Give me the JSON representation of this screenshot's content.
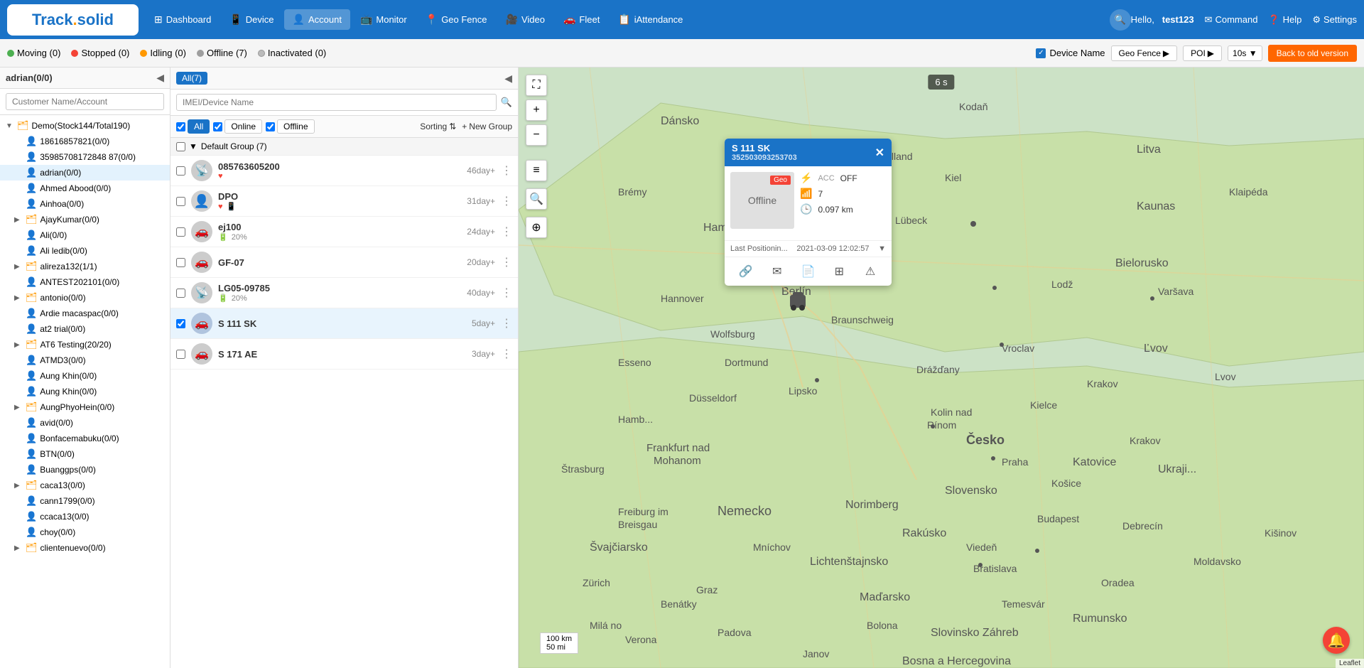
{
  "app": {
    "title": "Track solid"
  },
  "nav": {
    "logo": "Track solid",
    "items": [
      {
        "label": "Dashboard",
        "icon": "⊞",
        "key": "dashboard"
      },
      {
        "label": "Device",
        "icon": "📱",
        "key": "device"
      },
      {
        "label": "Account",
        "icon": "👤",
        "key": "account",
        "active": true
      },
      {
        "label": "Monitor",
        "icon": "📺",
        "key": "monitor"
      },
      {
        "label": "Geo Fence",
        "icon": "📍",
        "key": "geo-fence"
      },
      {
        "label": "Video",
        "icon": "🎥",
        "key": "video"
      },
      {
        "label": "Fleet",
        "icon": "🚗",
        "key": "fleet"
      },
      {
        "label": "iAttendance",
        "icon": "📋",
        "key": "iattendance"
      }
    ],
    "hello_text": "Hello,",
    "username": "test123",
    "command": "Command",
    "help": "Help",
    "settings": "Settings"
  },
  "status_bar": {
    "moving": {
      "label": "Moving",
      "count": "0"
    },
    "stopped": {
      "label": "Stopped",
      "count": "0"
    },
    "idling": {
      "label": "Idling",
      "count": "0"
    },
    "offline": {
      "label": "Offline",
      "count": "7"
    },
    "inactivated": {
      "label": "Inactivated",
      "count": "0"
    },
    "device_name_label": "Device Name",
    "geo_fence_label": "Geo Fence",
    "poi_label": "POI",
    "interval": "10s",
    "back_old_version": "Back to old version"
  },
  "sidebar": {
    "title": "adrian(0/0)",
    "search_placeholder": "Customer Name/Account",
    "accounts": [
      {
        "label": "Demo(Stock144/Total190)",
        "type": "folder",
        "level": 0,
        "expanded": true
      },
      {
        "label": "18616857821(0/0)",
        "type": "person-orange",
        "level": 1
      },
      {
        "label": "35985708172848 87(0/0)",
        "type": "person-orange",
        "level": 1
      },
      {
        "label": "adrian(0/0)",
        "type": "person-orange",
        "level": 1,
        "selected": true
      },
      {
        "label": "Ahmed Abood(0/0)",
        "type": "person",
        "level": 1
      },
      {
        "label": "Ainhoa(0/0)",
        "type": "person",
        "level": 1
      },
      {
        "label": "AjayKumar(0/0)",
        "type": "folder",
        "level": 1,
        "expanded": false
      },
      {
        "label": "Ali(0/0)",
        "type": "person",
        "level": 1
      },
      {
        "label": "Ali ledib(0/0)",
        "type": "person",
        "level": 1
      },
      {
        "label": "alireza132(1/1)",
        "type": "folder",
        "level": 1
      },
      {
        "label": "ANTEST202101(0/0)",
        "type": "person",
        "level": 1
      },
      {
        "label": "antonio(0/0)",
        "type": "folder",
        "level": 1
      },
      {
        "label": "Ardie macaspac(0/0)",
        "type": "person",
        "level": 1
      },
      {
        "label": "at2 trial(0/0)",
        "type": "person",
        "level": 1
      },
      {
        "label": "AT6 Testing(20/20)",
        "type": "folder",
        "level": 1
      },
      {
        "label": "ATMD3(0/0)",
        "type": "person",
        "level": 1
      },
      {
        "label": "Aung Khin(0/0)",
        "type": "person",
        "level": 1
      },
      {
        "label": "Aung Khin(0/0)",
        "type": "person",
        "level": 1
      },
      {
        "label": "AungPhyoHein(0/0)",
        "type": "folder",
        "level": 1
      },
      {
        "label": "avid(0/0)",
        "type": "person",
        "level": 1
      },
      {
        "label": "Bonfacemabuku(0/0)",
        "type": "person",
        "level": 1
      },
      {
        "label": "BTN(0/0)",
        "type": "person",
        "level": 1
      },
      {
        "label": "Buanggps(0/0)",
        "type": "person",
        "level": 1
      },
      {
        "label": "caca13(0/0)",
        "type": "folder",
        "level": 1
      },
      {
        "label": "cann1799(0/0)",
        "type": "person",
        "level": 1
      },
      {
        "label": "ccaca13(0/0)",
        "type": "person",
        "level": 1
      },
      {
        "label": "choy(0/0)",
        "type": "person",
        "level": 1
      },
      {
        "label": "clientenuevo(0/0)",
        "type": "folder",
        "level": 1
      }
    ]
  },
  "device_panel": {
    "all_label": "All(7)",
    "search_placeholder": "IMEI/Device Name",
    "filter_all": "All",
    "filter_online": "Online",
    "filter_offline": "Offline",
    "sorting_label": "Sorting",
    "new_group_label": "New Group",
    "group_name": "Default Group (7)",
    "devices": [
      {
        "name": "085763605200",
        "age": "46day+",
        "sub_icons": [
          "heart"
        ],
        "icon": "gps"
      },
      {
        "name": "DPO",
        "age": "31day+",
        "sub_icons": [
          "heart",
          "phone"
        ],
        "icon": "person"
      },
      {
        "name": "ej100",
        "age": "24day+",
        "sub_icons": [
          "battery20"
        ],
        "icon": "car"
      },
      {
        "name": "GF-07",
        "age": "20day+",
        "sub_icons": [],
        "icon": "car"
      },
      {
        "name": "LG05-09785",
        "age": "40day+",
        "sub_icons": [
          "battery20"
        ],
        "icon": "gps"
      },
      {
        "name": "S 111 SK",
        "age": "5day+",
        "sub_icons": [],
        "icon": "car",
        "selected": true
      },
      {
        "name": "S 171 AE",
        "age": "3day+",
        "sub_icons": [],
        "icon": "car"
      }
    ]
  },
  "map": {
    "timer": "6 s",
    "scale_100km": "100 km",
    "scale_50mi": "50 mi"
  },
  "popup": {
    "title": "S 111 SK",
    "device_id": "352503093253703",
    "status": "Offline",
    "acc": "OFF",
    "acc_label": "OFF",
    "signal": "7",
    "distance": "0.097 km",
    "geo_label": "Geo",
    "last_position_label": "Last Positionin...",
    "last_position_time": "2021-03-09 12:02:57",
    "action_icons": [
      "link",
      "email",
      "document",
      "grid",
      "alert"
    ]
  }
}
